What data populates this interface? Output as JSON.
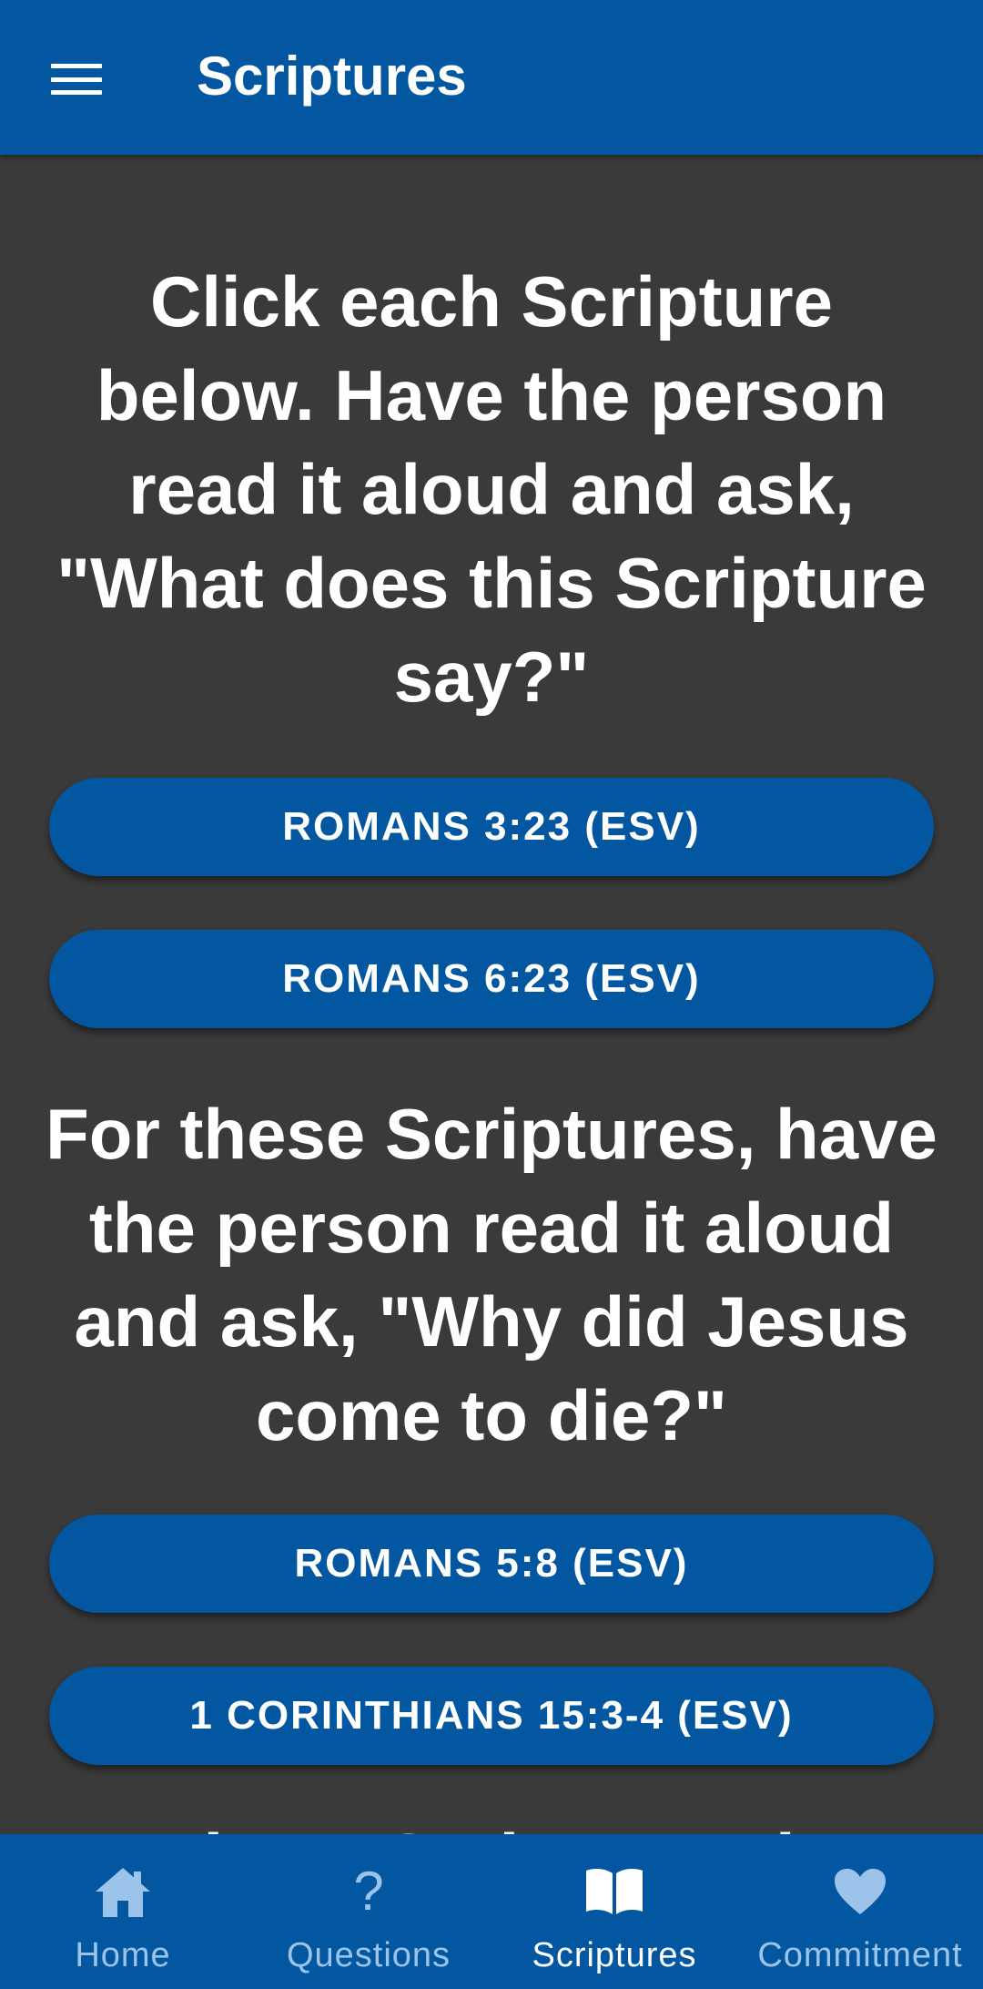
{
  "header": {
    "title": "Scriptures",
    "menu_icon": "hamburger-menu-icon"
  },
  "content": {
    "instruction_1": "Click each Scripture below. Have the person read it aloud and ask, \"What does this Scripture say?\"",
    "buttons_1": [
      {
        "label": "ROMANS 3:23 (ESV)"
      },
      {
        "label": "ROMANS 6:23 (ESV)"
      }
    ],
    "instruction_2": "For these Scriptures, have the person read it aloud and ask, \"Why did Jesus come to die?\"",
    "buttons_2": [
      {
        "label": "ROMANS 5:8 (ESV)"
      },
      {
        "label": "1 CORINTHIANS 15:3-4 (ESV)"
      }
    ],
    "instruction_3_partial": "For these Scriptures, have the person"
  },
  "bottom_nav": {
    "items": [
      {
        "label": "Home",
        "icon": "home-icon",
        "active": false
      },
      {
        "label": "Questions",
        "icon": "question-mark-icon",
        "active": false
      },
      {
        "label": "Scriptures",
        "icon": "open-book-icon",
        "active": true
      },
      {
        "label": "Commitment",
        "icon": "heart-icon",
        "active": false
      }
    ]
  },
  "colors": {
    "primary": "#0257a0",
    "background": "#3a3a3a",
    "text": "#ffffff",
    "nav_inactive": "#9cc3ea"
  }
}
